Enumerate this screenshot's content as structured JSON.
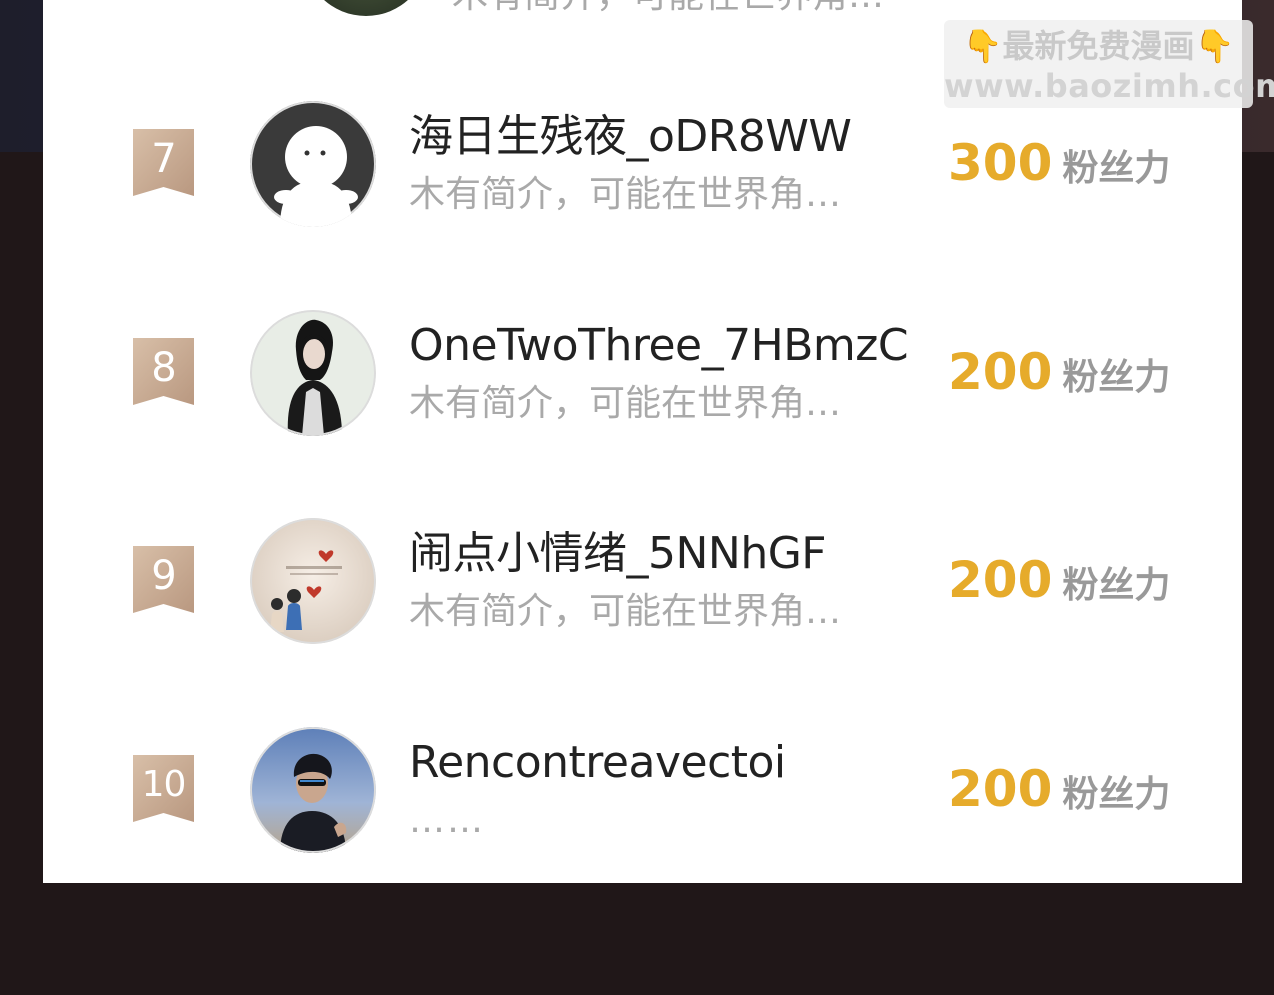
{
  "partial_top_row": {
    "bio": "木有简介，可能在世界角…"
  },
  "watermark": {
    "hand_icon": "👇",
    "line1": "最新免费漫画",
    "line2": "www.baozimh.com"
  },
  "fans_list": [
    {
      "rank": "7",
      "name": "海日生残夜_oDR8WW",
      "bio": "木有简介，可能在世界角…",
      "score": "300",
      "unit": "粉丝力",
      "avatar": "default-ghost-avatar"
    },
    {
      "rank": "8",
      "name": "OneTwoThree_7HBmzC",
      "bio": "木有简介，可能在世界角…",
      "score": "200",
      "unit": "粉丝力",
      "avatar": "man-black-jacket-avatar"
    },
    {
      "rank": "9",
      "name": "闹点小情绪_5NNhGF",
      "bio": "木有简介，可能在世界角…",
      "score": "200",
      "unit": "粉丝力",
      "avatar": "couple-illustration-avatar"
    },
    {
      "rank": "10",
      "name": "Rencontreavectoi",
      "bio": "……",
      "score": "200",
      "unit": "粉丝力",
      "avatar": "person-sunglasses-beach-avatar"
    }
  ],
  "colors": {
    "rank_badge": "#c9ab95",
    "score": "#e6ab2b",
    "unit": "#999999",
    "bio": "#a9a9a9",
    "name": "#222222"
  }
}
